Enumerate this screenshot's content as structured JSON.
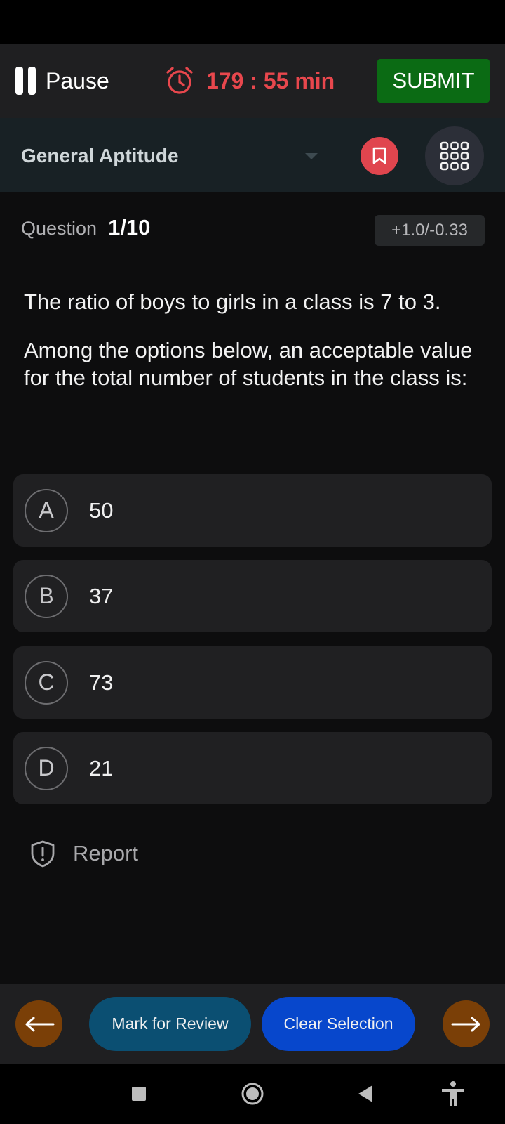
{
  "header": {
    "pause_label": "Pause",
    "timer_text": "179 : 55 min",
    "submit_label": "SUBMIT"
  },
  "section": {
    "title": "General Aptitude"
  },
  "question": {
    "label": "Question",
    "number": "1/10",
    "marks": "+1.0/-0.33",
    "paragraphs": [
      "The ratio of boys to girls in a class is 7 to 3.",
      "Among the options below, an acceptable value for the total number of students in the class is:"
    ]
  },
  "options": [
    {
      "letter": "A",
      "value": "50"
    },
    {
      "letter": "B",
      "value": "37"
    },
    {
      "letter": "C",
      "value": "73"
    },
    {
      "letter": "D",
      "value": "21"
    }
  ],
  "report_label": "Report",
  "footer": {
    "mark_review_label": "Mark for Review",
    "clear_selection_label": "Clear Selection"
  },
  "colors": {
    "timer": "#e8474d",
    "submit_bg": "#0b6b14",
    "bookmark_bg": "#e0454e",
    "nav_arrow_bg": "#7a3f07",
    "mark_review_bg": "#0b4f72",
    "clear_selection_bg": "#0747cc"
  },
  "icons": {
    "pause": "pause-icon",
    "timer": "alarm-clock-icon",
    "bookmark": "bookmark-icon",
    "grid": "grid-icon",
    "report": "shield-alert-icon",
    "prev": "arrow-left-icon",
    "next": "arrow-right-icon"
  }
}
